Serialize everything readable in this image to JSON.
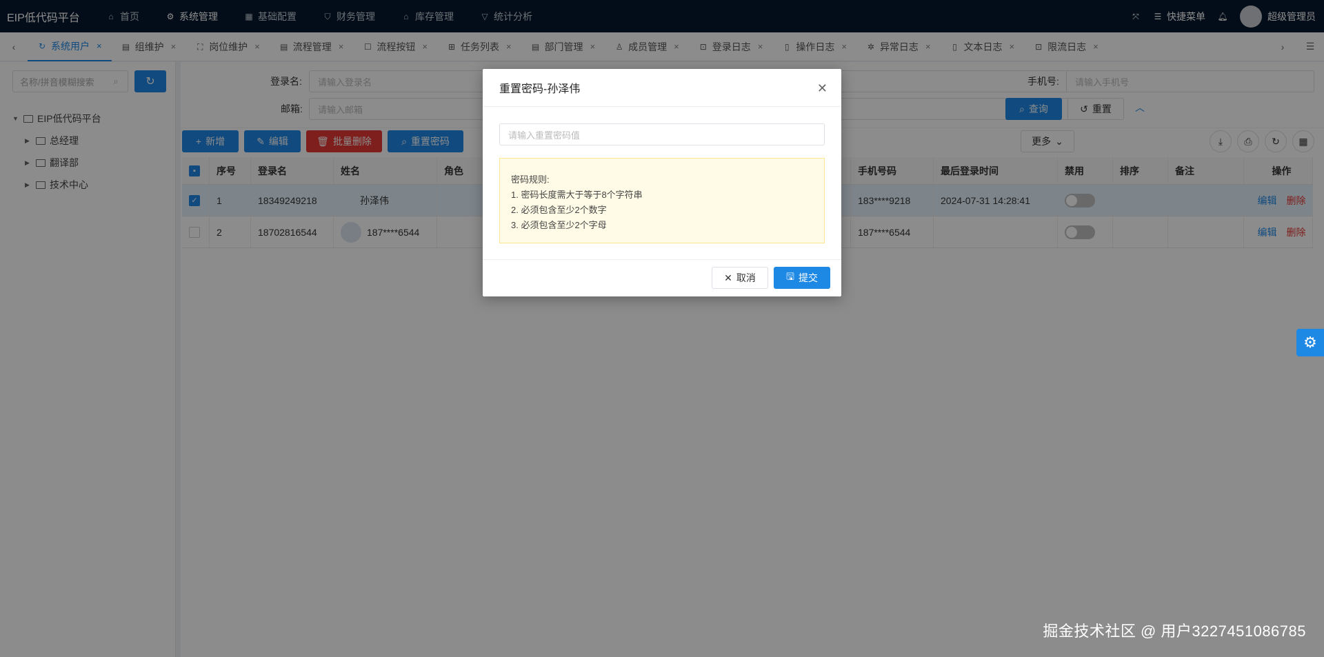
{
  "app": {
    "title": "EIP低代码平台"
  },
  "topnav": {
    "items": [
      {
        "label": "首页",
        "icon": "home-icon"
      },
      {
        "label": "系统管理",
        "icon": "gear-icon"
      },
      {
        "label": "基础配置",
        "icon": "grid-icon"
      },
      {
        "label": "财务管理",
        "icon": "shield-icon"
      },
      {
        "label": "库存管理",
        "icon": "bank-icon"
      },
      {
        "label": "统计分析",
        "icon": "funnel-icon"
      }
    ],
    "quick_menu": "快捷菜单",
    "user": "超级管理员"
  },
  "tabs": [
    {
      "label": "系统用户"
    },
    {
      "label": "组维护"
    },
    {
      "label": "岗位维护"
    },
    {
      "label": "流程管理"
    },
    {
      "label": "流程按钮"
    },
    {
      "label": "任务列表"
    },
    {
      "label": "部门管理"
    },
    {
      "label": "成员管理"
    },
    {
      "label": "登录日志"
    },
    {
      "label": "操作日志"
    },
    {
      "label": "异常日志"
    },
    {
      "label": "文本日志"
    },
    {
      "label": "限流日志"
    }
  ],
  "sidebar": {
    "search_placeholder": "名称/拼音模糊搜索",
    "tree_root": "EIP低代码平台",
    "tree_children": [
      "总经理",
      "翻译部",
      "技术中心"
    ]
  },
  "search": {
    "login_label": "登录名:",
    "login_placeholder": "请输入登录名",
    "email_label": "邮箱:",
    "email_placeholder": "请输入邮箱",
    "phone_label": "手机号:",
    "phone_placeholder": "请输入手机号",
    "query": "查询",
    "reset": "重置"
  },
  "toolbar": {
    "add": "新增",
    "edit": "编辑",
    "batch_delete": "批量删除",
    "reset_password": "重置密码",
    "more": "更多"
  },
  "table": {
    "headers": {
      "index": "序号",
      "login": "登录名",
      "name": "姓名",
      "role": "角色",
      "phone": "手机号码",
      "last_login": "最后登录时间",
      "disabled": "禁用",
      "sort": "排序",
      "remark": "备注",
      "action": "操作"
    },
    "rows": [
      {
        "index": "1",
        "login": "18349249218",
        "name": "孙泽伟",
        "phone": "183****9218",
        "last_login": "2024-07-31 14:28:41"
      },
      {
        "index": "2",
        "login": "18702816544",
        "name": "187****6544",
        "phone": "187****6544",
        "last_login": ""
      }
    ],
    "edit": "编辑",
    "delete": "删除"
  },
  "modal": {
    "title": "重置密码-孙泽伟",
    "placeholder": "请输入重置密码值",
    "rules_title": "密码规则:",
    "rule1": "1. 密码长度需大于等于8个字符串",
    "rule2": "2. 必须包含至少2个数字",
    "rule3": "3. 必须包含至少2个字母",
    "cancel": "取消",
    "submit": "提交"
  },
  "watermark": "掘金技术社区 @ 用户3227451086785"
}
